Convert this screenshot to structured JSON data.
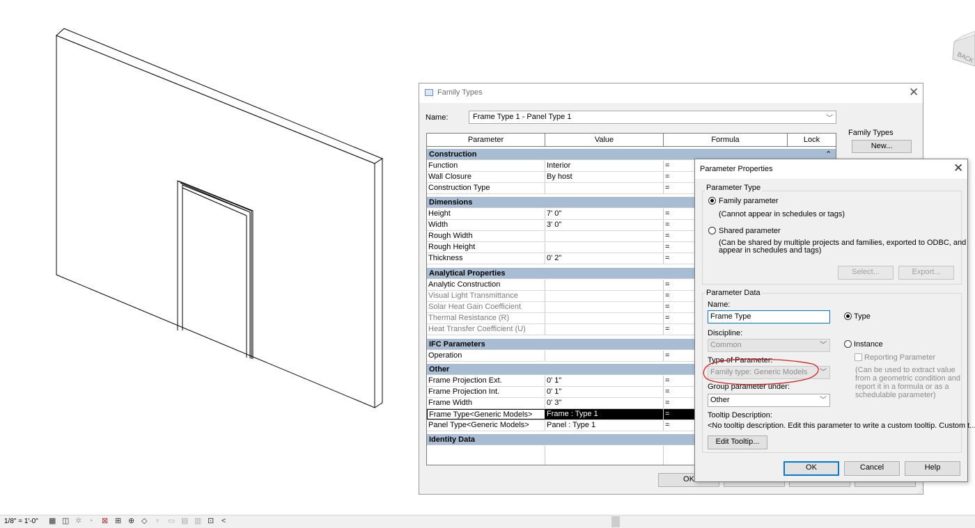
{
  "viewport": {
    "background": "#ffffff",
    "line_color": "#000000"
  },
  "viewcube": {
    "label": "BACK"
  },
  "statusbar": {
    "scale": "1/8\" = 1'-0\"",
    "collapse": "<"
  },
  "family_types": {
    "title": "Family Types",
    "name_label": "Name:",
    "name_value": "Frame Type 1 - Panel Type 1",
    "columns": [
      "Parameter",
      "Value",
      "Formula",
      "Lock"
    ],
    "groups": {
      "construction": "Construction",
      "dimensions": "Dimensions",
      "analytical": "Analytical Properties",
      "ifc": "IFC Parameters",
      "other": "Other",
      "identity": "Identity Data"
    },
    "rows": [
      {
        "param": "Function",
        "value": "Interior",
        "formula": "="
      },
      {
        "param": "Wall Closure",
        "value": "By host",
        "formula": "="
      },
      {
        "param": "Construction Type",
        "value": "",
        "formula": "="
      },
      {
        "param": "Height",
        "value": "7'  0\"",
        "formula": "="
      },
      {
        "param": "Width",
        "value": "3'  0\"",
        "formula": "="
      },
      {
        "param": "Rough Width",
        "value": "",
        "formula": "="
      },
      {
        "param": "Rough Height",
        "value": "",
        "formula": "="
      },
      {
        "param": "Thickness",
        "value": "0'  2\"",
        "formula": "="
      },
      {
        "param": "Analytic Construction",
        "value": "",
        "formula": "="
      },
      {
        "param": "Visual Light Transmittance",
        "value": "",
        "formula": "="
      },
      {
        "param": "Solar Heat Gain Coefficient",
        "value": "",
        "formula": "="
      },
      {
        "param": "Thermal Resistance (R)",
        "value": "",
        "formula": "="
      },
      {
        "param": "Heat Transfer Coefficient (U)",
        "value": "",
        "formula": "="
      },
      {
        "param": "Operation",
        "value": "",
        "formula": "="
      },
      {
        "param": "Frame Projection Ext.",
        "value": "0'  1\"",
        "formula": "="
      },
      {
        "param": "Frame Projection Int.",
        "value": "0'  1\"",
        "formula": "="
      },
      {
        "param": "Frame Width",
        "value": "0'  3\"",
        "formula": "="
      },
      {
        "param": "Frame Type<Generic Models>",
        "value": "Frame : Type 1",
        "formula": "="
      },
      {
        "param": "Panel Type<Generic Models>",
        "value": "Panel : Type 1",
        "formula": "="
      }
    ],
    "collapse_symbol": "⌃",
    "family_types_label": "Family Types",
    "new_button": "New...",
    "ok_button": "OK"
  },
  "parameter_properties": {
    "title": "Parameter Properties",
    "parameter_type_legend": "Parameter Type",
    "family_parameter": "Family parameter",
    "family_parameter_note": "(Cannot appear in schedules or tags)",
    "shared_parameter": "Shared parameter",
    "shared_parameter_note_1": "(Can be shared by multiple projects and families, exported to ODBC, and",
    "shared_parameter_note_2": "appear in schedules and tags)",
    "select_button": "Select...",
    "export_button": "Export...",
    "parameter_data_legend": "Parameter Data",
    "name_label": "Name:",
    "name_value": "Frame Type",
    "type_radio": "Type",
    "instance_radio": "Instance",
    "discipline_label": "Discipline:",
    "discipline_value": "Common",
    "reporting_parameter": "Reporting Parameter",
    "reporting_note_1": "(Can be used to extract value",
    "reporting_note_2": "from a geometric condition and",
    "reporting_note_3": "report it in a formula or as a",
    "reporting_note_4": "schedulable parameter)",
    "type_of_parameter_label": "Type of Parameter:",
    "type_of_parameter_value": "Family type: Generic Models",
    "group_label": "Group parameter under:",
    "group_value": "Other",
    "tooltip_label": "Tooltip Description:",
    "tooltip_value": "<No tooltip description. Edit this parameter to write a custom tooltip. Custom t...",
    "edit_tooltip_button": "Edit Tooltip...",
    "ok_button": "OK",
    "cancel_button": "Cancel",
    "help_button": "Help",
    "annotation_color": "#d42020"
  }
}
